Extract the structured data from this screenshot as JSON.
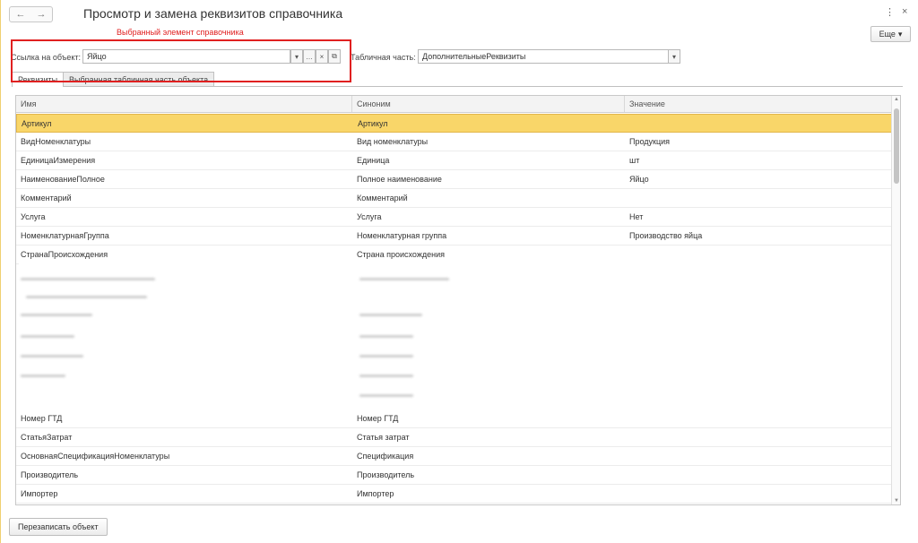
{
  "window": {
    "title": "Просмотр и замена реквизитов справочника",
    "back_glyph": "←",
    "forward_glyph": "→",
    "menu_glyph": "⋮",
    "close_glyph": "×"
  },
  "annotation": "Выбранный элемент справочника",
  "more_button": "Еще",
  "object_ref": {
    "label": "Ссылка на объект:",
    "value": "Яйцо"
  },
  "tabular_part": {
    "label": "Табличная часть:",
    "value": "ДополнительныеРеквизиты"
  },
  "tabs": [
    {
      "label": "Реквизиты",
      "active": true
    },
    {
      "label": "Выбранная табличная часть объекта",
      "active": false
    }
  ],
  "table": {
    "columns": [
      "Имя",
      "Синоним",
      "Значение"
    ],
    "rows": [
      [
        "Артикул",
        "Артикул",
        ""
      ],
      [
        "ВидНоменклатуры",
        "Вид номенклатуры",
        "Продукция"
      ],
      [
        "ЕдиницаИзмерения",
        "Единица",
        "шт"
      ],
      [
        "НаименованиеПолное",
        "Полное наименование",
        "Яйцо"
      ],
      [
        "Комментарий",
        "Комментарий",
        ""
      ],
      [
        "Услуга",
        "Услуга",
        "Нет"
      ],
      [
        "НоменклатурнаяГруппа",
        "Номенклатурная группа",
        "Производство яйца"
      ],
      [
        "СтранаПроисхождения",
        "Страна происхождения",
        ""
      ]
    ],
    "rows_bottom": [
      [
        "Номер ГТД",
        "Номер ГТД",
        ""
      ],
      [
        "СтатьяЗатрат",
        "Статья затрат",
        ""
      ],
      [
        "ОсновнаяСпецификацияНоменклатуры",
        "Спецификация",
        ""
      ],
      [
        "Производитель",
        "Производитель",
        ""
      ],
      [
        "Импортер",
        "Импортер",
        ""
      ]
    ]
  },
  "save_button": "Перезаписать объект",
  "colors": {
    "selected_row": "#f9d669",
    "annotation_red": "#e02020"
  }
}
